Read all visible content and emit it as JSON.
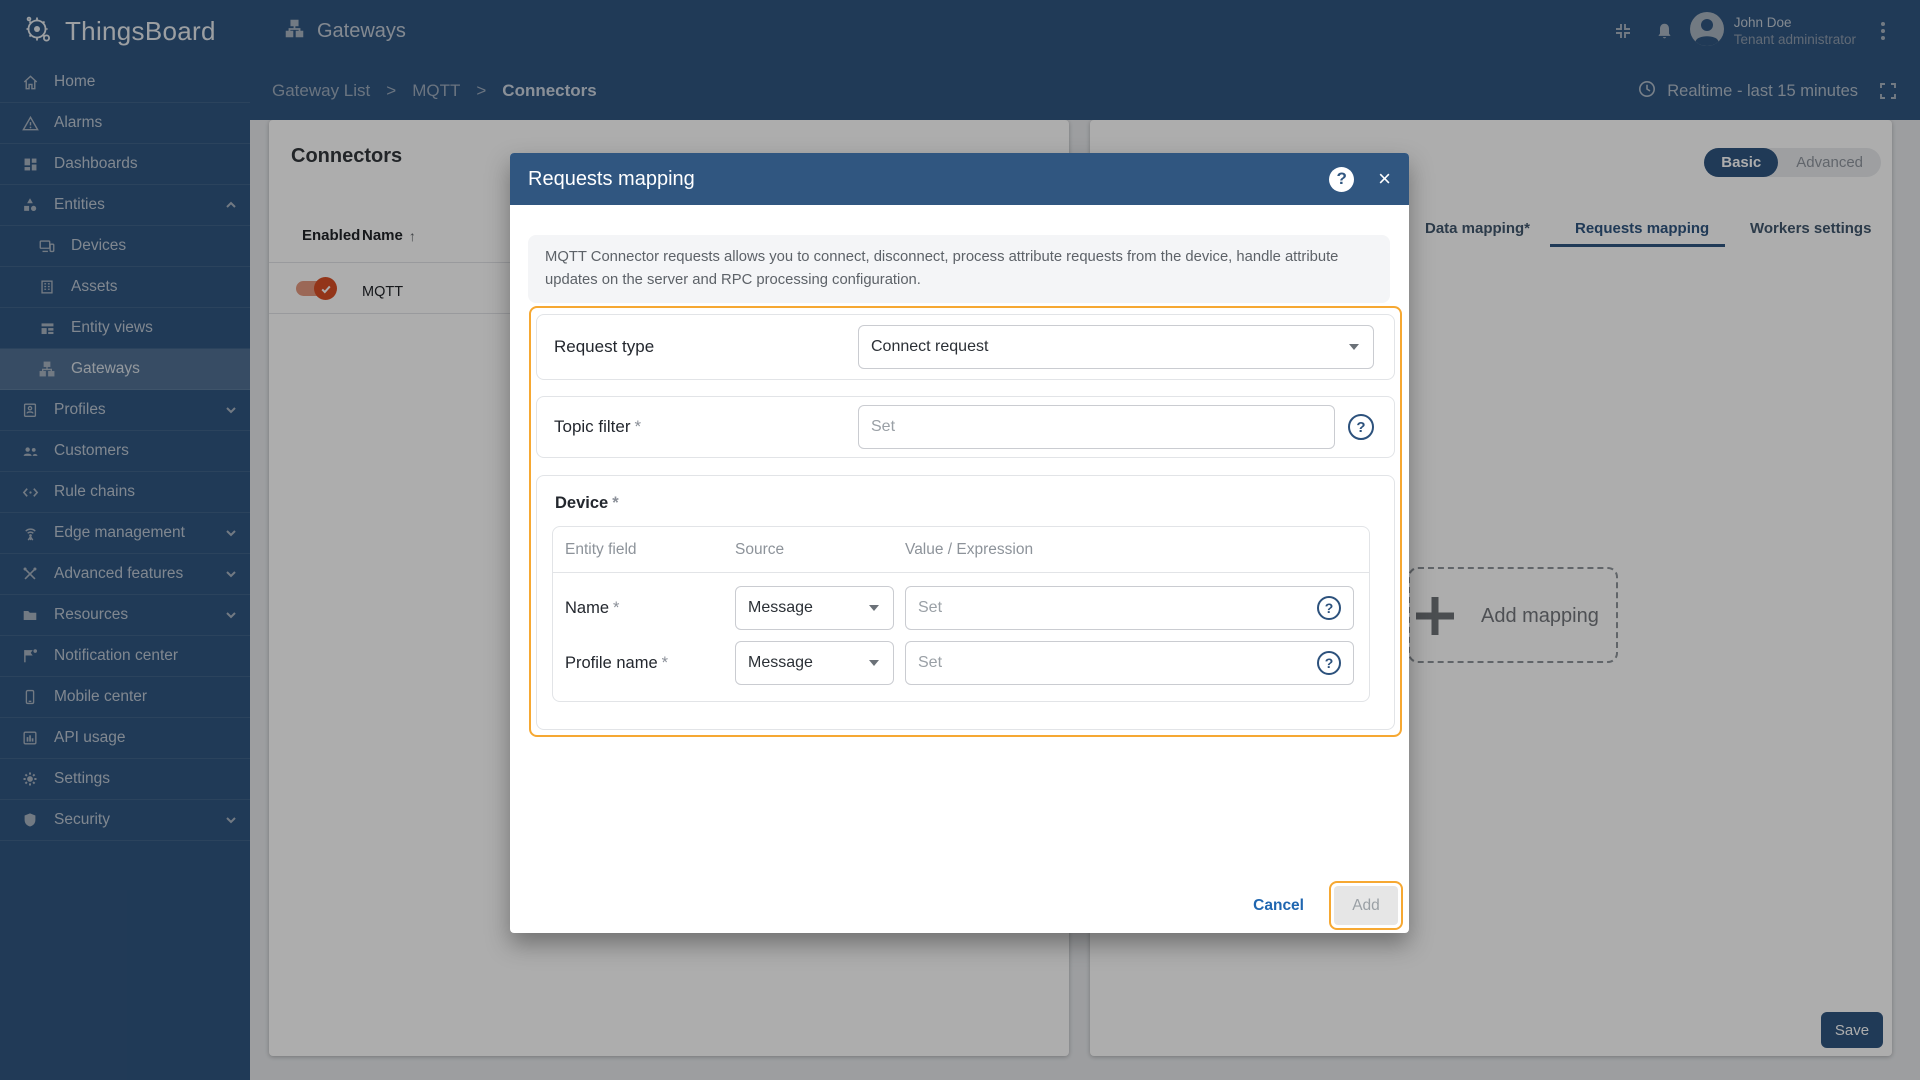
{
  "ui": {
    "required_mark": "*",
    "breadcrumb_separator": ">",
    "sort_arrow": "↑",
    "close_glyph": "×",
    "help_glyph": "?"
  },
  "colors": {
    "primary": "#305680",
    "highlight_orange": "#F6A832",
    "toggle_on": "#D94F26"
  },
  "topbar": {
    "brand": "ThingsBoard",
    "page_title": "Gateways",
    "user_name": "John Doe",
    "user_role": "Tenant administrator"
  },
  "breadcrumb": {
    "items": [
      {
        "label": "Gateway List"
      },
      {
        "label": "MQTT"
      },
      {
        "label": "Connectors"
      }
    ]
  },
  "toolbar": {
    "realtime": "Realtime - last 15 minutes"
  },
  "sidebar": {
    "items": [
      {
        "label": "Home"
      },
      {
        "label": "Alarms"
      },
      {
        "label": "Dashboards"
      },
      {
        "label": "Entities"
      },
      {
        "label": "Devices"
      },
      {
        "label": "Assets"
      },
      {
        "label": "Entity views"
      },
      {
        "label": "Gateways"
      },
      {
        "label": "Profiles"
      },
      {
        "label": "Customers"
      },
      {
        "label": "Rule chains"
      },
      {
        "label": "Edge management"
      },
      {
        "label": "Advanced features"
      },
      {
        "label": "Resources"
      },
      {
        "label": "Notification center"
      },
      {
        "label": "Mobile center"
      },
      {
        "label": "API usage"
      },
      {
        "label": "Settings"
      },
      {
        "label": "Security"
      }
    ]
  },
  "connectors_panel": {
    "title": "Connectors",
    "col_enabled": "Enabled",
    "col_name": "Name",
    "rows": [
      {
        "name": "MQTT",
        "enabled": true
      }
    ]
  },
  "config_panel": {
    "mode_basic": "Basic",
    "mode_advanced": "Advanced",
    "tabs": [
      {
        "label": "Data mapping*"
      },
      {
        "label": "Requests mapping"
      },
      {
        "label": "Workers settings"
      }
    ],
    "active_tab": "Requests mapping",
    "add_mapping": "Add mapping",
    "save": "Save"
  },
  "modal": {
    "title": "Requests mapping",
    "description": "MQTT Connector requests allows you to connect, disconnect, process attribute requests from the device, handle attribute updates on the server and RPC processing configuration.",
    "request_type": {
      "label": "Request type",
      "value": "Connect request"
    },
    "topic_filter": {
      "label": "Topic filter",
      "placeholder": "Set"
    },
    "device_section": {
      "title": "Device",
      "columns": [
        "Entity field",
        "Source",
        "Value / Expression"
      ],
      "rows": [
        {
          "field": "Name",
          "source": "Message",
          "value_placeholder": "Set"
        },
        {
          "field": "Profile name",
          "source": "Message",
          "value_placeholder": "Set"
        }
      ]
    },
    "footer": {
      "cancel": "Cancel",
      "add": "Add"
    }
  }
}
